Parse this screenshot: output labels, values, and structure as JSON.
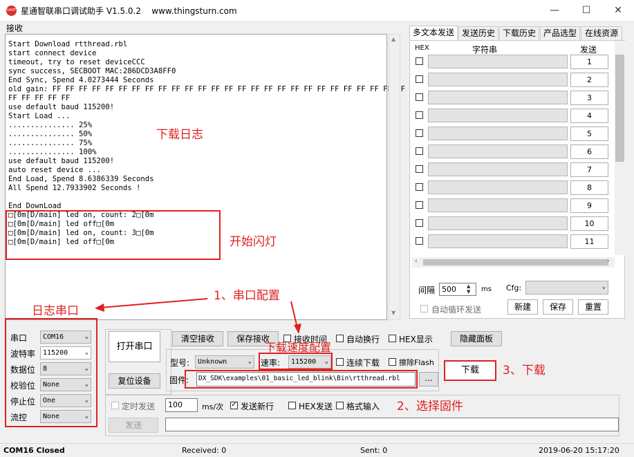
{
  "title": "星通智联串口调试助手 V1.5.0.2",
  "website": "www.thingsturn.com",
  "app_icon_text": "UART",
  "window_buttons": {
    "minimize": "—",
    "maximize": "☐",
    "close": "✕"
  },
  "recv_label": "接收",
  "log_text": "Start Download rtthread.rbl\nstart connect device\ntimeout, try to reset deviceCCC\nsync success, SECBOOT MAC:286DCD3A8FF0\nEnd Sync, Spend 4.0273444 Seconds\nold gain: FF FF FF FF FF FF FF FF FF FF FF FF FF FF FF FF FF FF FF FF FF FF FF FF FF FF FF FF\nFF FF FF FF FF\nuse default baud 115200!\nStart Load ...\n............... 25%\n............... 50%\n............... 75%\n............... 100%\nuse default baud 115200!\nauto reset device ...\nEnd Load, Spend 8.6386339 Seconds\nAll Spend 12.7933902 Seconds !\n\nEnd DownLoad\n□[0m[D/main] led on, count: 2□[0m\n□[0m[D/main] led off□[0m\n□[0m[D/main] led on, count: 3□[0m\n□[0m[D/main] led off□[0m",
  "annotations": {
    "download_log": "下载日志",
    "start_blink": "开始闪灯",
    "log_serial": "日志串口",
    "serial_config": "1、串口配置",
    "download_speed": "下载速度配置",
    "download": "3、下载",
    "select_firmware": "2、选择固件"
  },
  "tabs": [
    "多文本发送",
    "发送历史",
    "下载历史",
    "产品选型",
    "在线资源"
  ],
  "multi_send": {
    "hex_header": "HEX",
    "string_header": "字符串",
    "send_header": "发送",
    "rows": [
      "1",
      "2",
      "3",
      "4",
      "5",
      "6",
      "7",
      "8",
      "9",
      "10",
      "11"
    ]
  },
  "interval": {
    "label": "间隔",
    "value": "500",
    "unit": "ms",
    "cycle_label": "自动循环发送"
  },
  "cfg": {
    "label": "Cfg:",
    "new": "新建",
    "save": "保存",
    "reset": "重置"
  },
  "serial": {
    "port_label": "串口",
    "port": "COM16",
    "baud_label": "波特率",
    "baud": "115200",
    "databits_label": "数据位",
    "databits": "8",
    "parity_label": "校验位",
    "parity": "None",
    "stopbits_label": "停止位",
    "stopbits": "One",
    "flow_label": "流控",
    "flow": "None"
  },
  "buttons": {
    "open_port": "打开串口",
    "reset_device": "复位设备",
    "clear_recv": "清空接收",
    "save_recv": "保存接收",
    "hide_panel": "隐藏面板",
    "download": "下载",
    "browse": "...",
    "send": "发送"
  },
  "checks": {
    "recv_time": "接收时间",
    "auto_wrap": "自动换行",
    "hex_display": "HEX显示",
    "continuous": "连续下载",
    "erase_flash": "擦除Flash",
    "timed_send": "定时发送",
    "newline": "发送新行",
    "hex_send": "HEX发送",
    "format_input": "格式输入"
  },
  "download_cfg": {
    "model_label": "型号:",
    "model": "Unknown",
    "speed_label": "速率:",
    "speed": "115200",
    "firmware_label": "固件:",
    "firmware_path": "DX_SDK\\examples\\01_basic_led_blink\\Bin\\rtthread.rbl"
  },
  "timer": {
    "value": "100",
    "unit": "ms/次"
  },
  "status": {
    "port": "COM16 Closed",
    "received": "Received: 0",
    "sent": "Sent: 0",
    "time": "2019-06-20 15:17:20"
  },
  "colors": {
    "annotation": "#e02020",
    "icon": "#d9302c"
  }
}
